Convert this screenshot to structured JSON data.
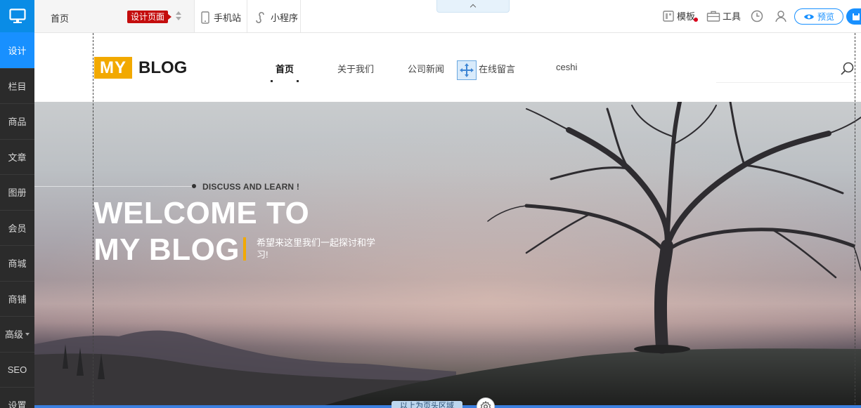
{
  "sidebar": {
    "logo_icon": "monitor-icon",
    "items": [
      {
        "label": "设计",
        "active": true
      },
      {
        "label": "栏目"
      },
      {
        "label": "商品"
      },
      {
        "label": "文章"
      },
      {
        "label": "图册"
      },
      {
        "label": "会员"
      },
      {
        "label": "商城"
      },
      {
        "label": "商铺"
      },
      {
        "label": "高级",
        "has_dropdown": true
      },
      {
        "label": "SEO"
      },
      {
        "label": "设置"
      }
    ],
    "add_label": "+"
  },
  "toolbar": {
    "page_label": "首页",
    "design_badge": "设计页面",
    "mobile_label": "手机站",
    "miniapp_label": "小程序",
    "template_label": "模板",
    "tools_label": "工具",
    "preview_label": "预览"
  },
  "site": {
    "logo_my": "MY",
    "logo_blog": "BLOG",
    "nav": [
      {
        "label": "首页",
        "active": true
      },
      {
        "label": "关于我们"
      },
      {
        "label": "公司新闻"
      },
      {
        "label": "在线留言"
      },
      {
        "label": "ceshi"
      }
    ]
  },
  "hero": {
    "kicker": "DISCUSS AND LEARN !",
    "title_line1": "WELCOME TO",
    "title_line2": "MY BLOG",
    "subtitle": "希望来这里我们一起探讨和学习!"
  },
  "footer": {
    "area_label": "以上为页头区域"
  },
  "colors": {
    "sidebar_bg": "#2b2b2b",
    "accent_blue": "#1890ff",
    "badge_red": "#c40d0d",
    "brand_yellow": "#f2a900"
  }
}
